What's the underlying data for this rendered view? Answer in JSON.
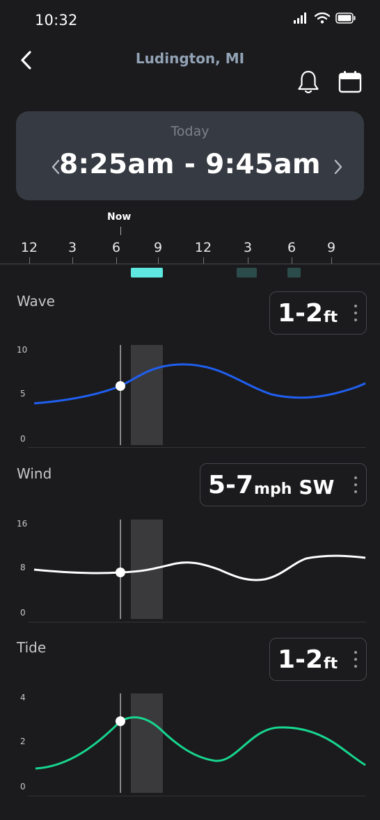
{
  "status_bar": {
    "time": "10:32"
  },
  "header": {
    "title": "Ludington, MI"
  },
  "time_window": {
    "day": "Today",
    "range": "8:25am - 9:45am"
  },
  "timeline": {
    "now_label": "Now",
    "ticks": [
      "12",
      "3",
      "6",
      "9",
      "12",
      "3",
      "6",
      "9"
    ],
    "colors": {
      "selected": "#5ee8e0",
      "other": "#2c4c4b"
    }
  },
  "wave": {
    "label": "Wave",
    "value": "1-2",
    "unit": "ft",
    "axis": [
      "10",
      "5",
      "0"
    ],
    "color": "#1f5ff0"
  },
  "wind": {
    "label": "Wind",
    "value": "5-7",
    "unit": "mph",
    "direction": "SW",
    "axis": [
      "16",
      "8",
      "0"
    ],
    "color": "#ffffff"
  },
  "tide": {
    "label": "Tide",
    "value": "1-2",
    "unit": "ft",
    "axis": [
      "4",
      "2",
      "0"
    ],
    "color": "#17d68f"
  }
}
